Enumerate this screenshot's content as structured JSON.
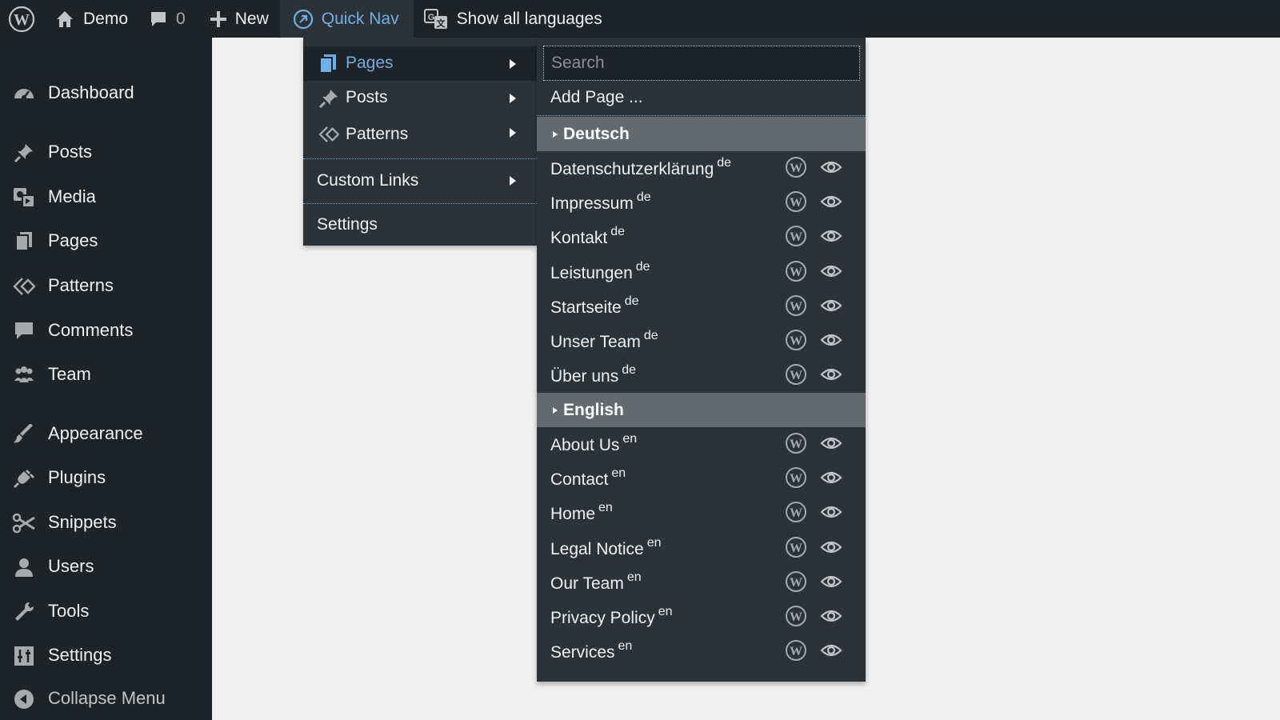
{
  "colors": {
    "admin_bg": "#1d2327",
    "submenu_bg": "#2c3338",
    "accent": "#72aee6",
    "lang_header_bg": "#646970",
    "text": "#f0f0f1"
  },
  "adminbar": {
    "wp_logo_icon": "wordpress-logo-icon",
    "site_name": "Demo",
    "comments_count": "0",
    "new_label": "New",
    "quicknav_label": "Quick Nav",
    "languages_label": "Show all languages"
  },
  "sidebar": {
    "items": [
      {
        "label": "Dashboard",
        "icon": "dashboard-icon"
      },
      {
        "label": "Posts",
        "icon": "pin-icon"
      },
      {
        "label": "Media",
        "icon": "media-icon"
      },
      {
        "label": "Pages",
        "icon": "pages-icon"
      },
      {
        "label": "Patterns",
        "icon": "patterns-icon"
      },
      {
        "label": "Comments",
        "icon": "comment-icon"
      },
      {
        "label": "Team",
        "icon": "groups-icon"
      },
      {
        "label": "Appearance",
        "icon": "brush-icon"
      },
      {
        "label": "Plugins",
        "icon": "plug-icon"
      },
      {
        "label": "Snippets",
        "icon": "scissors-icon"
      },
      {
        "label": "Users",
        "icon": "user-icon"
      },
      {
        "label": "Tools",
        "icon": "wrench-icon"
      },
      {
        "label": "Settings",
        "icon": "sliders-icon"
      }
    ],
    "collapse_label": "Collapse Menu"
  },
  "quicknav": {
    "items": {
      "pages": "Pages",
      "posts": "Posts",
      "patterns": "Patterns",
      "custom_links": "Custom Links",
      "settings": "Settings"
    }
  },
  "submenu": {
    "search_placeholder": "Search",
    "add_page_label": "Add Page ...",
    "languages": [
      {
        "name": "Deutsch",
        "code": "de",
        "pages": [
          "Datenschutzerklärung",
          "Impressum",
          "Kontakt",
          "Leistungen",
          "Startseite",
          "Unser Team",
          "Über uns"
        ]
      },
      {
        "name": "English",
        "code": "en",
        "pages": [
          "About Us",
          "Contact",
          "Home",
          "Legal Notice",
          "Our Team",
          "Privacy Policy",
          "Services"
        ]
      }
    ]
  }
}
